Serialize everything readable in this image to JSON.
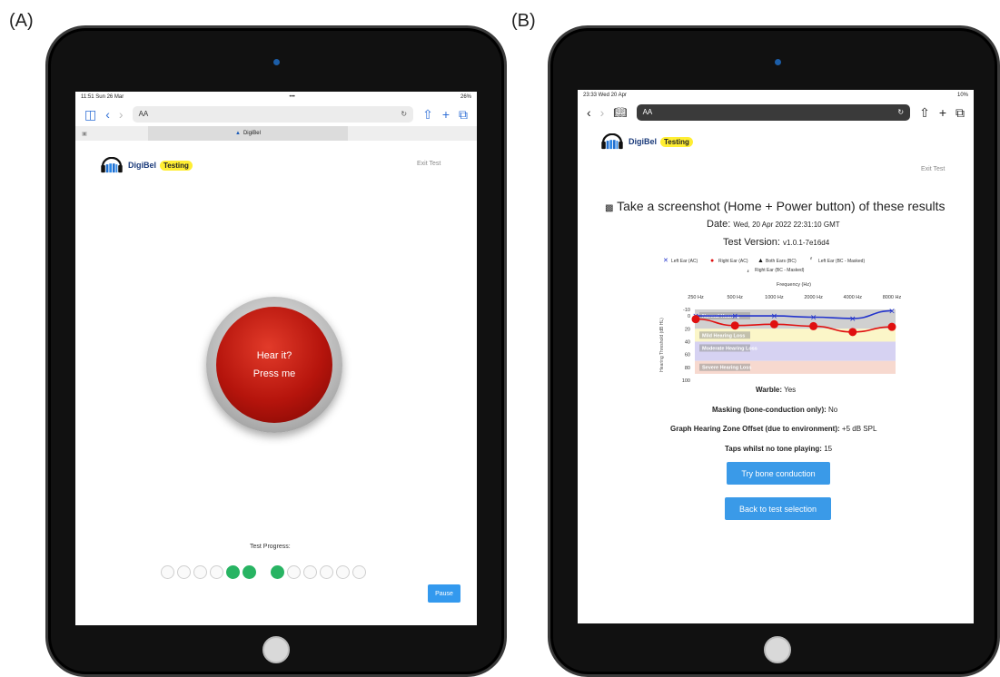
{
  "panels": {
    "a_label": "(A)",
    "b_label": "(B)"
  },
  "left": {
    "status_time": "11:51  Sun 26 Mar",
    "status_center": "•••",
    "status_battery": "26%",
    "url_text": "AA",
    "tab_title": "DigiBel",
    "logo_text": "DigiBel",
    "badge": "Testing",
    "exit": "Exit Test",
    "button_line1": "Hear it?",
    "button_line2": "Press me",
    "progress_label": "Test Progress:",
    "progress_dots_on": [
      4,
      5,
      6
    ],
    "progress_total": 12,
    "pause": "Pause"
  },
  "right": {
    "status_time": "23:33  Wed 20 Apr",
    "status_battery": "10%",
    "url_text": "AA",
    "logo_text": "DigiBel",
    "badge": "Testing",
    "exit": "Exit Test",
    "heading": "Take a screenshot (Home + Power button) of these results",
    "date_label": "Date:",
    "date_value": "Wed, 20 Apr 2022 22:31:10 GMT",
    "version_label": "Test Version:",
    "version_value": "v1.0.1-7e16d4",
    "warble_label": "Warble:",
    "warble_value": "Yes",
    "masking_label": "Masking (bone-conduction only):",
    "masking_value": "No",
    "offset_label": "Graph Hearing Zone Offset (due to environment):",
    "offset_value": "+5 dB SPL",
    "taps_label": "Taps whilst no tone playing:",
    "taps_value": "15",
    "btn_bone": "Try bone conduction",
    "btn_back": "Back to test selection"
  },
  "chart_data": {
    "type": "line",
    "title": "Frequency (Hz)",
    "xlabel": "Frequency (Hz)",
    "ylabel": "Hearing Threshold (dB HL)",
    "categories": [
      "250 Hz",
      "500 Hz",
      "1000 Hz",
      "2000 Hz",
      "4000 Hz",
      "8000 Hz"
    ],
    "ylim": [
      -10,
      100
    ],
    "yticks": [
      -10,
      0,
      20,
      40,
      60,
      80,
      100
    ],
    "legend": [
      "Left Ear (AC)",
      "Right Ear (AC)",
      "Both Ears (BC)",
      "Left Ear (BC - Masked)",
      "Right Ear (BC - Masked)"
    ],
    "series": [
      {
        "name": "Left Ear (AC)",
        "color": "#2233cc",
        "values": [
          0,
          0,
          0,
          2,
          4,
          -8
        ]
      },
      {
        "name": "Right Ear (AC)",
        "color": "#e01010",
        "values": [
          5,
          15,
          13,
          16,
          25,
          17
        ]
      }
    ],
    "zones": [
      {
        "label": "Normal Hearing",
        "from": -10,
        "to": 20,
        "color": "#d0d0d0"
      },
      {
        "label": "Mild Hearing Loss",
        "from": 20,
        "to": 40,
        "color": "#fbf6c8"
      },
      {
        "label": "Moderate Hearing Loss",
        "from": 40,
        "to": 70,
        "color": "#d6d2f2"
      },
      {
        "label": "Severe Hearing Loss",
        "from": 70,
        "to": 90,
        "color": "#f7d9cf"
      }
    ]
  }
}
